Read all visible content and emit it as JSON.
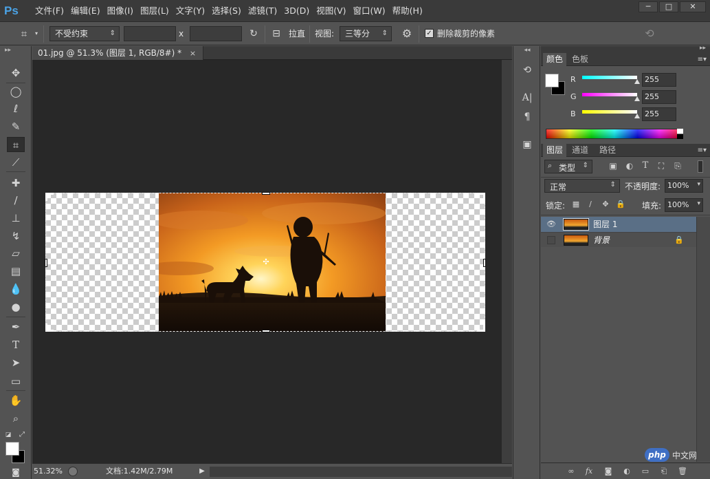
{
  "app": {
    "logo": "Ps",
    "menu": [
      "文件(F)",
      "编辑(E)",
      "图像(I)",
      "图层(L)",
      "文字(Y)",
      "选择(S)",
      "滤镜(T)",
      "3D(D)",
      "视图(V)",
      "窗口(W)",
      "帮助(H)"
    ],
    "window_controls": [
      "─",
      "□",
      "✕"
    ]
  },
  "options": {
    "ratio_select": "不受约束",
    "x_label": "x",
    "straighten_label": "拉直",
    "view_label": "视图:",
    "view_select": "三等分",
    "delete_cropped_label": "删除裁剪的像素",
    "delete_cropped_checked": true
  },
  "document": {
    "tab_title": "01.jpg @ 51.3% (图层 1, RGB/8#) *",
    "tab_close": "×",
    "zoom": "51.32%",
    "doc_info": "文档:1.42M/2.79M"
  },
  "color_panel": {
    "tabs": [
      "颜色",
      "色板"
    ],
    "channels": [
      {
        "label": "R",
        "value": "255",
        "color": "#00ffff"
      },
      {
        "label": "G",
        "value": "255",
        "color": "#ff00ff"
      },
      {
        "label": "B",
        "value": "255",
        "color": "#ffff00"
      }
    ]
  },
  "layers_panel": {
    "tabs": [
      "图层",
      "通道",
      "路径"
    ],
    "filter_select": "类型",
    "blend_mode": "正常",
    "opacity_label": "不透明度:",
    "opacity_value": "100%",
    "lock_label": "锁定:",
    "fill_label": "填充:",
    "fill_value": "100%",
    "layers": [
      {
        "name": "图层 1",
        "visible": true,
        "selected": true
      },
      {
        "name": "背景",
        "visible": false,
        "selected": false,
        "locked": true
      }
    ]
  },
  "watermark": {
    "logo": "php",
    "text": "中文网"
  }
}
